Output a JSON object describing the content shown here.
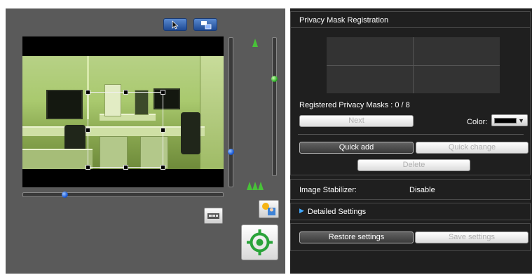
{
  "right_panel": {
    "privacy_mask": {
      "title": "Privacy Mask Registration",
      "registered_label": "Registered Privacy Masks : 0 / 8",
      "next_label": "Next",
      "color_label": "Color:",
      "color_value": "#000000",
      "quick_add_label": "Quick add",
      "quick_change_label": "Quick change",
      "delete_label": "Delete"
    },
    "image_stabilizer": {
      "label": "Image Stabilizer:",
      "value": "Disable"
    },
    "detailed_settings": {
      "label": "Detailed Settings",
      "icon": "triangle-right-icon"
    },
    "restore_label": "Restore settings",
    "save_label": "Save settings"
  },
  "left_panel": {
    "toolbar_icons": [
      "cursor-icon",
      "resize-window-icon"
    ],
    "zoom_slider_level": 0.85,
    "focus_slider_level": 0.4,
    "pan_slider_level": 0.2,
    "side_icons": [
      "tree-single-icon",
      "tree-triple-icon",
      "display-icon",
      "auto-adjust-icon",
      "target-icon"
    ]
  },
  "colors": {
    "panel_bg": "#5a5a5a",
    "settings_bg": "#1f1f1f",
    "accent_blue": "#1c5cd8",
    "accent_green": "#32b12a"
  }
}
